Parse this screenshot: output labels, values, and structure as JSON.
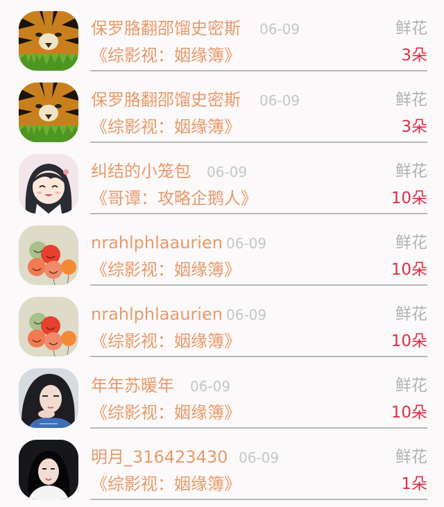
{
  "gift_label": "鲜花",
  "colors": {
    "name": "#e89a6a",
    "date": "#c6c6c8",
    "gift_label": "#b2b2b4",
    "count": "#dd2e44",
    "divider": "#b7b7b9",
    "background": "#fbf9fa"
  },
  "entries": [
    {
      "user": "保罗胳翻邵馏史密斯",
      "date": "06-09",
      "book": "《综影视：姻缘簿》",
      "count": "3朵",
      "avatar": "tiger-avatar"
    },
    {
      "user": "保罗胳翻邵馏史密斯",
      "date": "06-09",
      "book": "《综影视：姻缘簿》",
      "count": "3朵",
      "avatar": "tiger-avatar"
    },
    {
      "user": "纠结的小笼包",
      "date": "06-09",
      "book": "《哥谭：攻略企鹅人》",
      "count": "10朵",
      "avatar": "anime-girl-avatar"
    },
    {
      "user": "nrahlphlaaurien",
      "date": "06-09",
      "book": "《综影视：姻缘簿》",
      "count": "10朵",
      "avatar": "balloons-avatar"
    },
    {
      "user": "nrahlphlaaurien",
      "date": "06-09",
      "book": "《综影视：姻缘簿》",
      "count": "10朵",
      "avatar": "balloons-avatar"
    },
    {
      "user": "年年苏暖年",
      "date": "06-09",
      "book": "《综影视：姻缘簿》",
      "count": "10朵",
      "avatar": "woman-portrait-avatar"
    },
    {
      "user": "明月_316423430",
      "date": "06-09",
      "book": "《综影视：姻缘簿》",
      "count": "1朵",
      "avatar": "girl-portrait-avatar"
    }
  ]
}
